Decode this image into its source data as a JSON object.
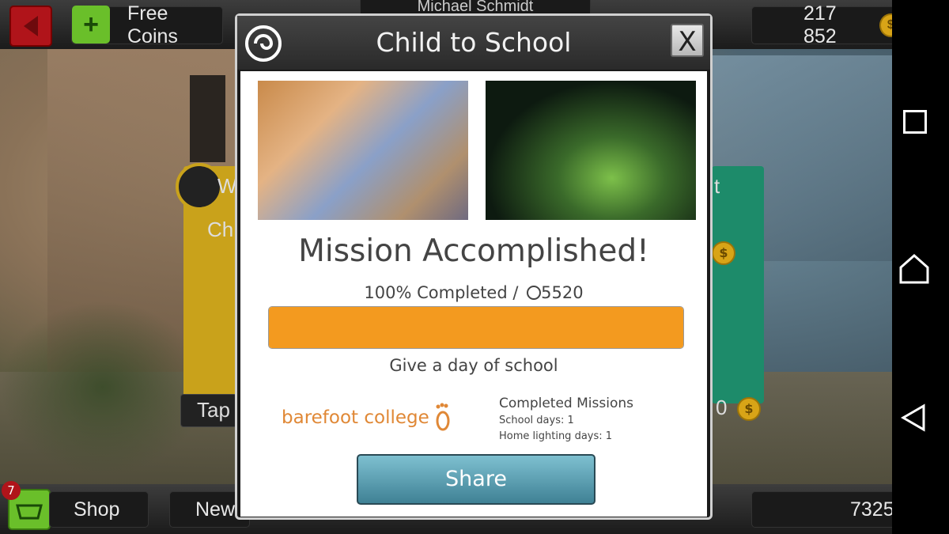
{
  "top_bar": {
    "free_coins_label": "Free Coins",
    "player_name": "Michael Schmidt",
    "coin_balance": "217 852"
  },
  "bottom_bar": {
    "notification_count": "7",
    "shop_label": "Shop",
    "news_label": "New",
    "points_balance": "7325"
  },
  "background_cards": {
    "left_title": "W",
    "left_sub": "Ch",
    "left_button": "Tap",
    "right_title": "t",
    "right_value": "0"
  },
  "dialog": {
    "title": "Child to School",
    "close_label": "X",
    "headline": "Mission Accomplished!",
    "progress_percent": 100,
    "progress_prefix": "100% Completed /",
    "progress_points": "5520",
    "cause": "Give a day of school",
    "partner_name": "barefoot college",
    "completed_title": "Completed Missions",
    "school_days": "School days: 1",
    "lighting_days": "Home lighting days: 1",
    "share_label": "Share"
  },
  "colors": {
    "progress": "#f39a1f",
    "partner": "#e08836",
    "share": "#4f93a6",
    "add_button": "#6abf2a",
    "back_button": "#b0141a"
  },
  "icons": [
    "back-arrow-icon",
    "plus-icon",
    "coin-icon",
    "swirl-logo-icon",
    "close-icon",
    "footprint-icon",
    "basket-icon",
    "nav-square-icon",
    "nav-home-icon",
    "nav-back-icon"
  ]
}
